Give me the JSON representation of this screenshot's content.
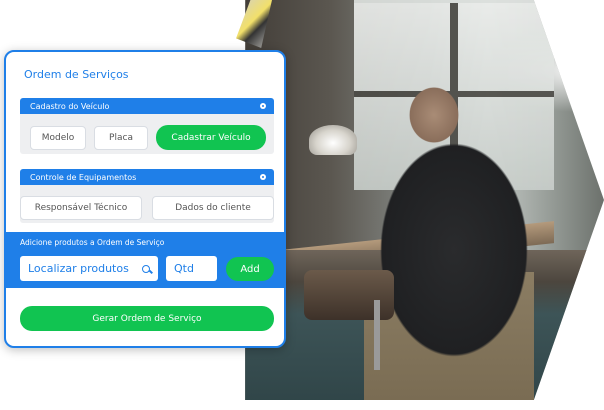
{
  "form": {
    "title": "Ordem de Serviços",
    "vehicle_section": {
      "header": "Cadastro do Veículo",
      "fields": [
        "Modelo",
        "Placa"
      ],
      "button": "Cadastrar Veículo"
    },
    "equipment_section": {
      "header": "Controle de Equipamentos",
      "fields": [
        "Responsável Técnico",
        "Dados do cliente"
      ]
    },
    "products": {
      "header": "Adicione produtos a Ordem de Serviço",
      "search_label": "Localizar produtos",
      "qty_label": "Qtd",
      "add_button": "Add"
    },
    "submit_button": "Gerar Ordem de Serviço"
  },
  "colors": {
    "primary": "#1f7fe8",
    "success": "#11c451"
  },
  "icons": [
    "search-icon",
    "collapse-icon"
  ]
}
